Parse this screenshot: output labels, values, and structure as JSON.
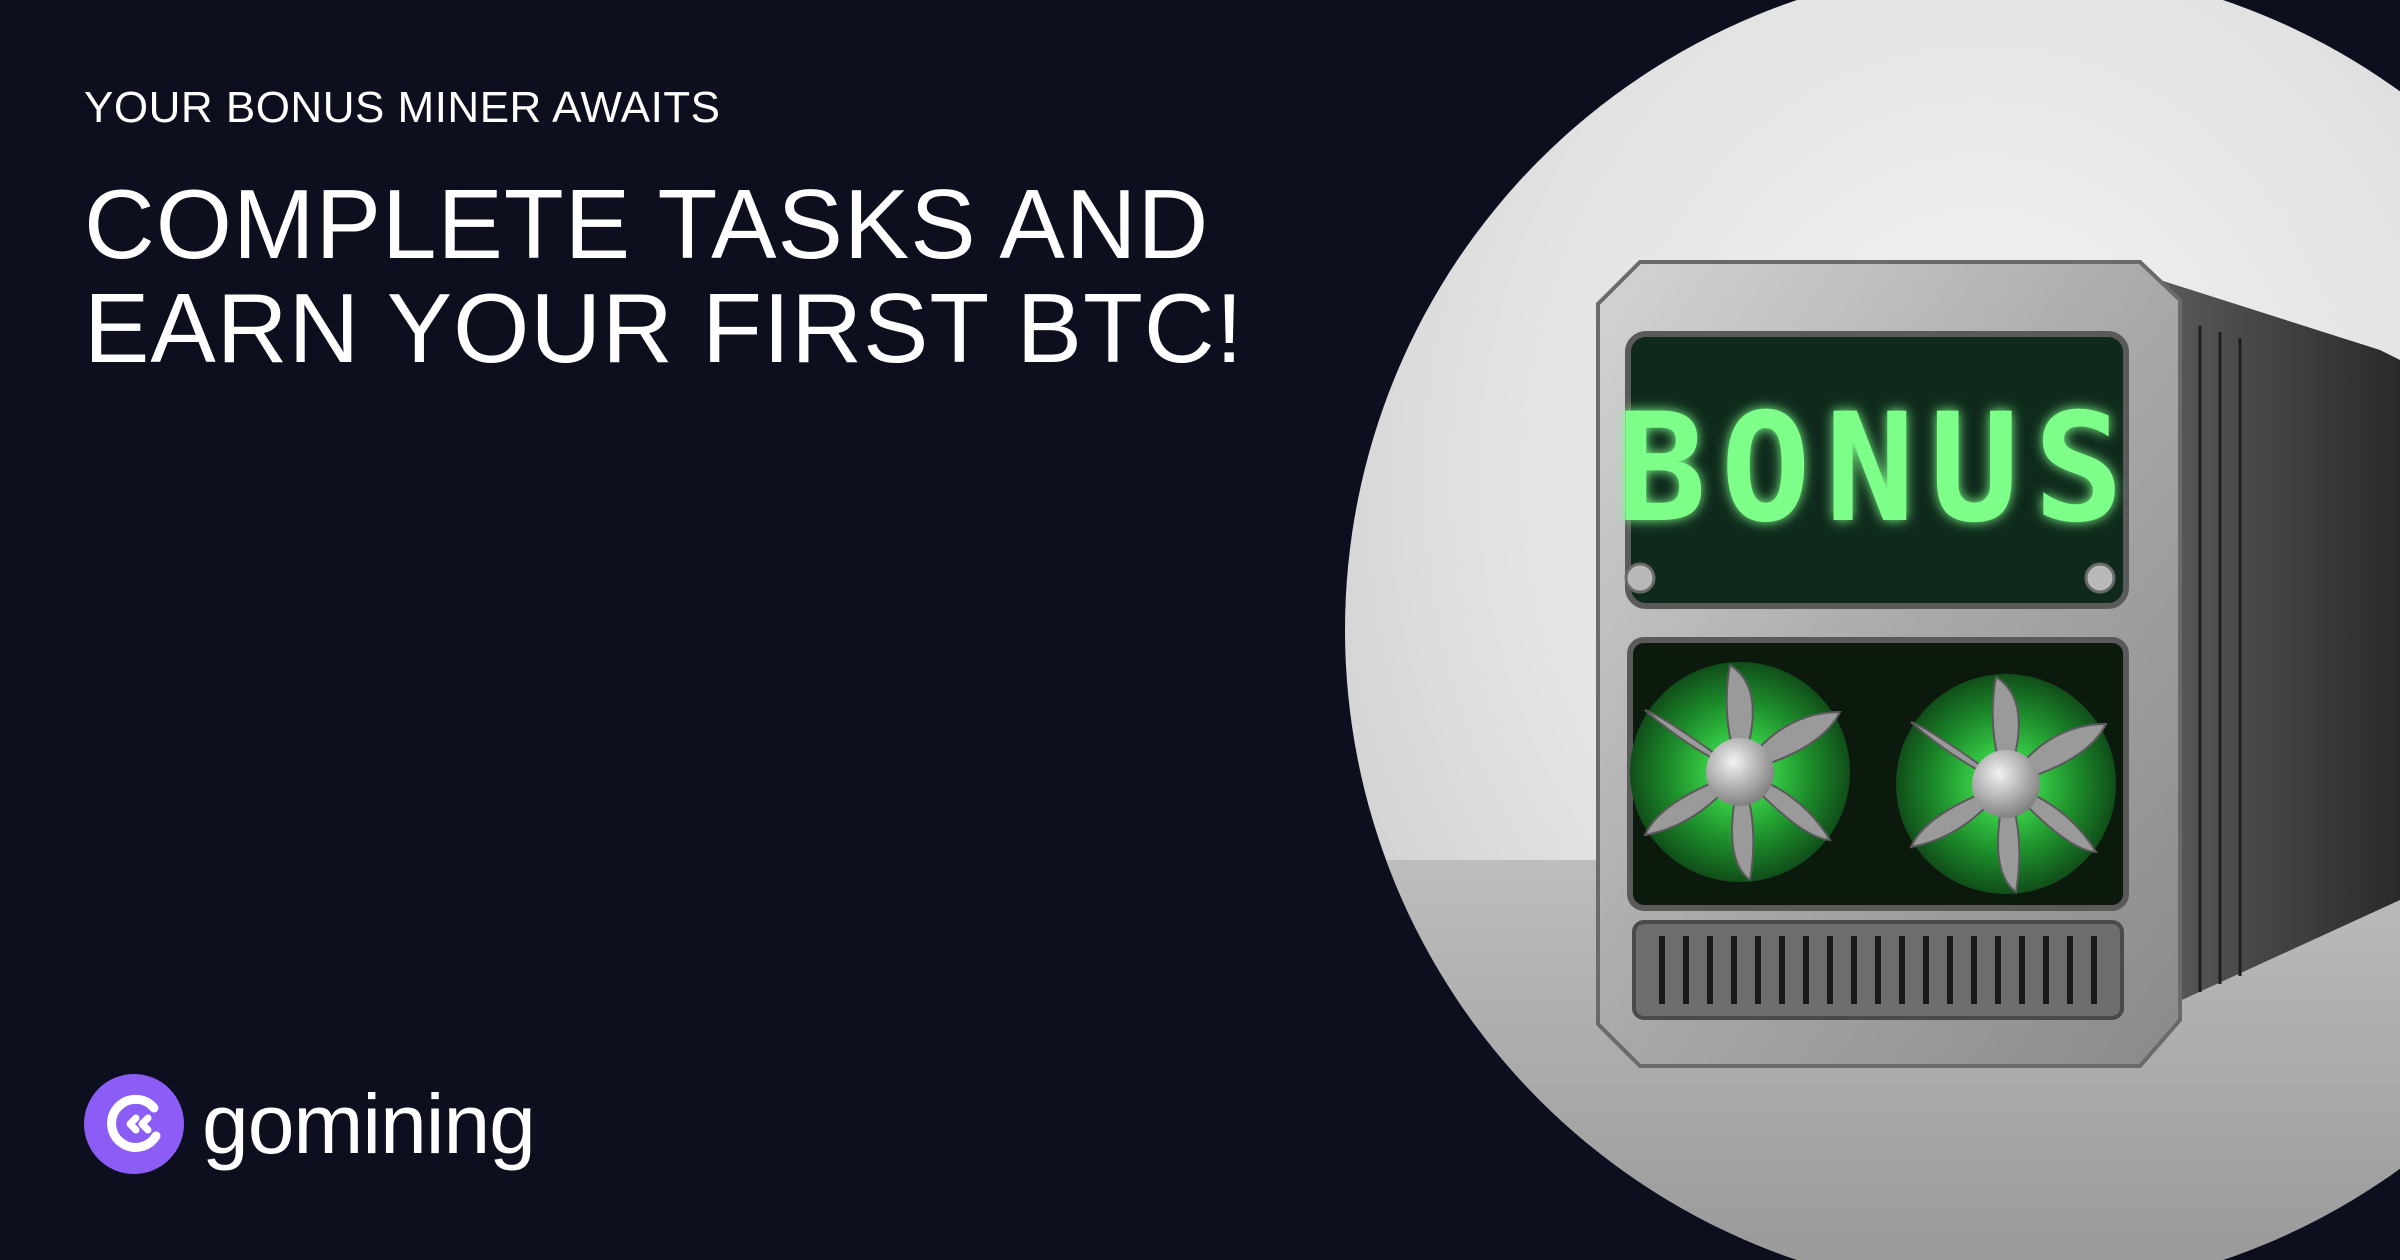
{
  "banner": {
    "eyebrow": "YOUR BONUS MINER AWAITS",
    "headline_line_1": "COMPLETE TASKS AND",
    "headline_line_2": "EARN YOUR FIRST BTC!",
    "brand_name": "gomining",
    "screen_label": "BONUS"
  },
  "icons": {
    "brand_logo": "gomining-logo-icon",
    "fan": "fan-icon"
  },
  "colors": {
    "background": "#0d0f1e",
    "text": "#ffffff",
    "brand_purple": "#8b5cf6",
    "screen_green": "#7dff8a"
  }
}
